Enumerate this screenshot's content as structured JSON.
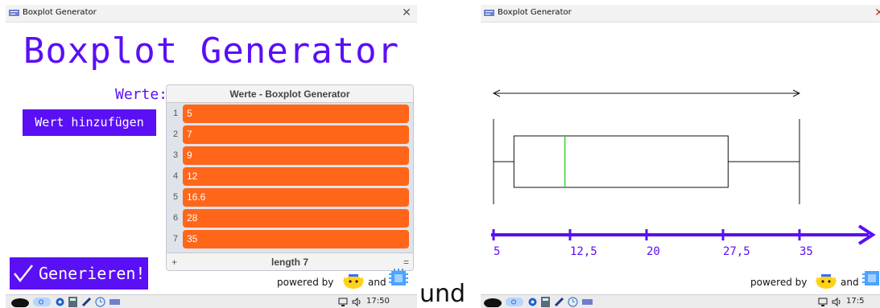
{
  "window": {
    "title": "Boxplot Generator"
  },
  "app": {
    "heading": "Boxplot Generator",
    "werte_label": "Werte:",
    "add_button": "Wert hinzufügen",
    "generate_button": "Generieren!",
    "powered_by": "powered by",
    "and": "and"
  },
  "list": {
    "title": "Werte - Boxplot Generator",
    "items": [
      "5",
      "7",
      "9",
      "12",
      "16.6",
      "28",
      "35"
    ],
    "length_label": "length 7",
    "add_symbol": "+",
    "menu_symbol": "="
  },
  "separator_text": "und",
  "taskbar": {
    "time_left": "17:50",
    "time_right": "17:5"
  },
  "chart_data": {
    "type": "boxplot",
    "values": [
      5,
      7,
      9,
      12,
      16.6,
      28,
      35
    ],
    "min": 5,
    "q1": 7,
    "median": 12,
    "q3": 28,
    "max": 35,
    "range_arrow": [
      5,
      35
    ],
    "ticks": [
      5,
      12.5,
      20,
      27.5,
      35
    ],
    "tick_labels": [
      "5",
      "12,5",
      "20",
      "27,5",
      "35"
    ],
    "axis_color": "#5a0ff5",
    "median_color": "#22cc22"
  },
  "colors": {
    "accent": "#5a0ff5",
    "item": "#ff661a"
  }
}
